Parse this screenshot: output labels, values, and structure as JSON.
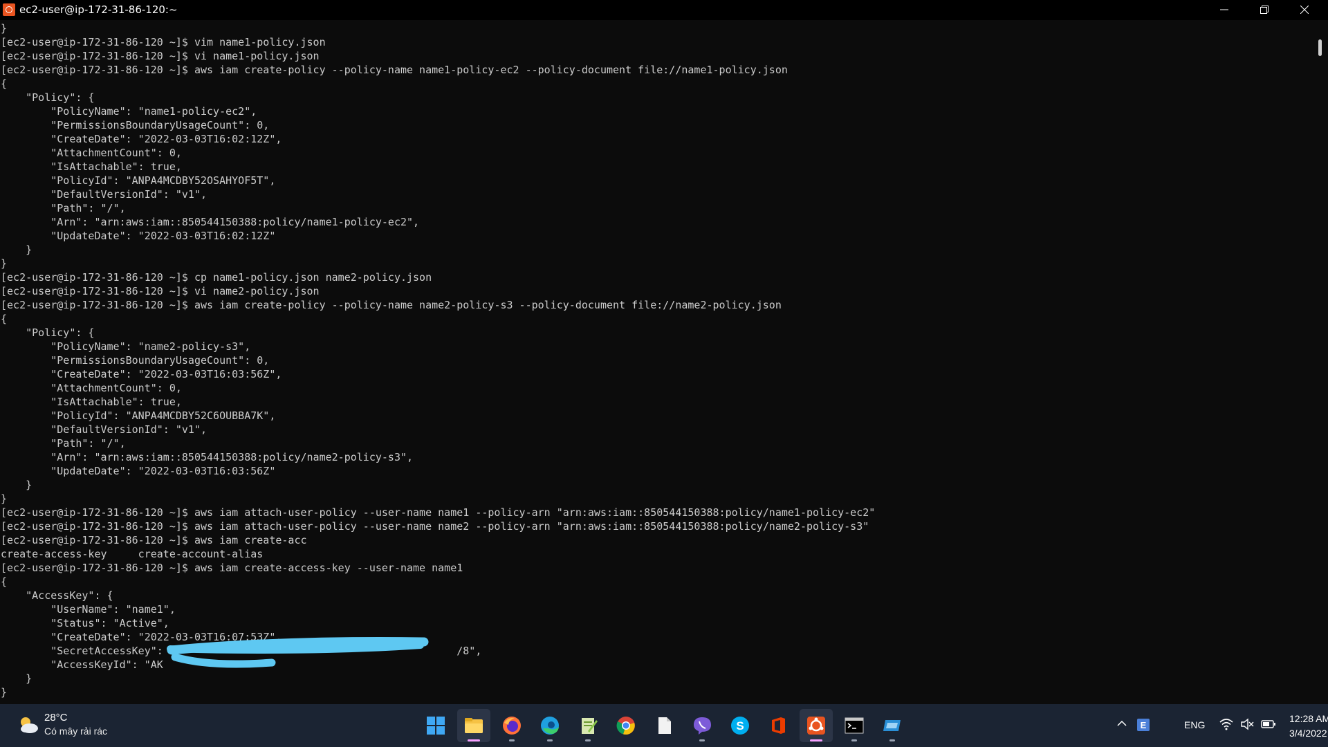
{
  "window": {
    "title": "ec2-user@ip-172-31-86-120:~",
    "icon": "ubuntu-icon",
    "controls": [
      "minimize-icon",
      "maximize-icon",
      "close-icon"
    ]
  },
  "terminal": {
    "lines": [
      "}",
      "[ec2-user@ip-172-31-86-120 ~]$ vim name1-policy.json",
      "[ec2-user@ip-172-31-86-120 ~]$ vi name1-policy.json",
      "[ec2-user@ip-172-31-86-120 ~]$ aws iam create-policy --policy-name name1-policy-ec2 --policy-document file://name1-policy.json",
      "{",
      "    \"Policy\": {",
      "        \"PolicyName\": \"name1-policy-ec2\",",
      "        \"PermissionsBoundaryUsageCount\": 0,",
      "        \"CreateDate\": \"2022-03-03T16:02:12Z\",",
      "        \"AttachmentCount\": 0,",
      "        \"IsAttachable\": true,",
      "        \"PolicyId\": \"ANPA4MCDBY52OSAHYOF5T\",",
      "        \"DefaultVersionId\": \"v1\",",
      "        \"Path\": \"/\",",
      "        \"Arn\": \"arn:aws:iam::850544150388:policy/name1-policy-ec2\",",
      "        \"UpdateDate\": \"2022-03-03T16:02:12Z\"",
      "    }",
      "}",
      "[ec2-user@ip-172-31-86-120 ~]$ cp name1-policy.json name2-policy.json",
      "[ec2-user@ip-172-31-86-120 ~]$ vi name2-policy.json",
      "[ec2-user@ip-172-31-86-120 ~]$ aws iam create-policy --policy-name name2-policy-s3 --policy-document file://name2-policy.json",
      "{",
      "    \"Policy\": {",
      "        \"PolicyName\": \"name2-policy-s3\",",
      "        \"PermissionsBoundaryUsageCount\": 0,",
      "        \"CreateDate\": \"2022-03-03T16:03:56Z\",",
      "        \"AttachmentCount\": 0,",
      "        \"IsAttachable\": true,",
      "        \"PolicyId\": \"ANPA4MCDBY52C6OUBBA7K\",",
      "        \"DefaultVersionId\": \"v1\",",
      "        \"Path\": \"/\",",
      "        \"Arn\": \"arn:aws:iam::850544150388:policy/name2-policy-s3\",",
      "        \"UpdateDate\": \"2022-03-03T16:03:56Z\"",
      "    }",
      "}",
      "[ec2-user@ip-172-31-86-120 ~]$ aws iam attach-user-policy --user-name name1 --policy-arn \"arn:aws:iam::850544150388:policy/name1-policy-ec2\"",
      "[ec2-user@ip-172-31-86-120 ~]$ aws iam attach-user-policy --user-name name2 --policy-arn \"arn:aws:iam::850544150388:policy/name2-policy-s3\"",
      "[ec2-user@ip-172-31-86-120 ~]$ aws iam create-acc",
      "create-access-key     create-account-alias",
      "[ec2-user@ip-172-31-86-120 ~]$ aws iam create-access-key --user-name name1",
      "{",
      "    \"AccessKey\": {",
      "        \"UserName\": \"name1\",",
      "        \"Status\": \"Active\",",
      "        \"CreateDate\": \"2022-03-03T16:07:53Z\",",
      "        \"SecretAccessKey\": \"                                             /8\",",
      "        \"AccessKeyId\": \"AK                \"",
      "    }",
      "}"
    ]
  },
  "taskbar": {
    "weather": {
      "temperature": "28°C",
      "description": "Có mây rải rác",
      "icon": "partly-cloudy-icon"
    },
    "apps": [
      {
        "name": "windows-start-icon",
        "active": false,
        "running": false
      },
      {
        "name": "file-explorer-icon",
        "active": true,
        "running": true
      },
      {
        "name": "firefox-icon",
        "active": false,
        "running": true
      },
      {
        "name": "edge-icon",
        "active": false,
        "running": true
      },
      {
        "name": "notepad-plus-plus-icon",
        "active": false,
        "running": true
      },
      {
        "name": "chrome-icon",
        "active": false,
        "running": false
      },
      {
        "name": "file-icon",
        "active": false,
        "running": false
      },
      {
        "name": "viber-icon",
        "active": false,
        "running": true
      },
      {
        "name": "skype-icon",
        "active": false,
        "running": false
      },
      {
        "name": "office-icon",
        "active": false,
        "running": false
      },
      {
        "name": "ubuntu-icon",
        "active": true,
        "running": true
      },
      {
        "name": "command-prompt-icon",
        "active": false,
        "running": true
      },
      {
        "name": "remote-desktop-icon",
        "active": false,
        "running": true
      }
    ],
    "tray": {
      "language": "ENG",
      "time": "12:28 AM",
      "date": "3/4/2022"
    }
  },
  "colors": {
    "terminal_bg": "#0c0c0c",
    "terminal_fg": "#cccccc",
    "taskbar_bg": "#1b2433",
    "redaction": "#5ec8f2",
    "ubuntu_orange": "#e95420"
  }
}
